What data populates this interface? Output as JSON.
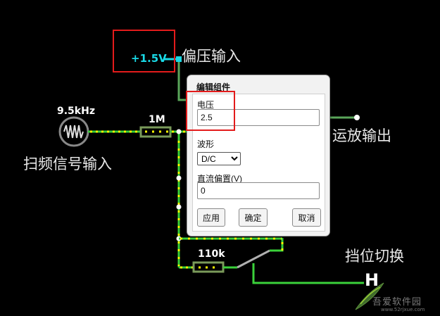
{
  "circuit": {
    "bias_voltage": "+1.5V",
    "bias_input_label": "偏压输入",
    "frequency_label": "9.5kHz",
    "sweep_input_label": "扫频信号输入",
    "resistor1_value": "1M",
    "resistor2_value": "110k",
    "opamp_output_label": "运放输出",
    "switch_label": "挡位切换",
    "switch_state": "H"
  },
  "dialog": {
    "title": "编辑组件",
    "voltage_label": "电压",
    "voltage_value": "2.5",
    "waveform_label": "波形",
    "waveform_selected": "D/C",
    "dc_offset_label": "直流偏置(V)",
    "dc_offset_value": "0",
    "apply_label": "应用",
    "ok_label": "确定",
    "cancel_label": "取消"
  },
  "watermark": {
    "text": "吾爱软件园",
    "url": "www.52rjxue.com"
  },
  "colors": {
    "background": "#000000",
    "wire_green": "#3ad13a",
    "wire_gray": "#6a9a6a",
    "current_dots": "#ffff00",
    "voltage_cyan": "#19d9e6",
    "highlight_red": "#e31b1b"
  }
}
